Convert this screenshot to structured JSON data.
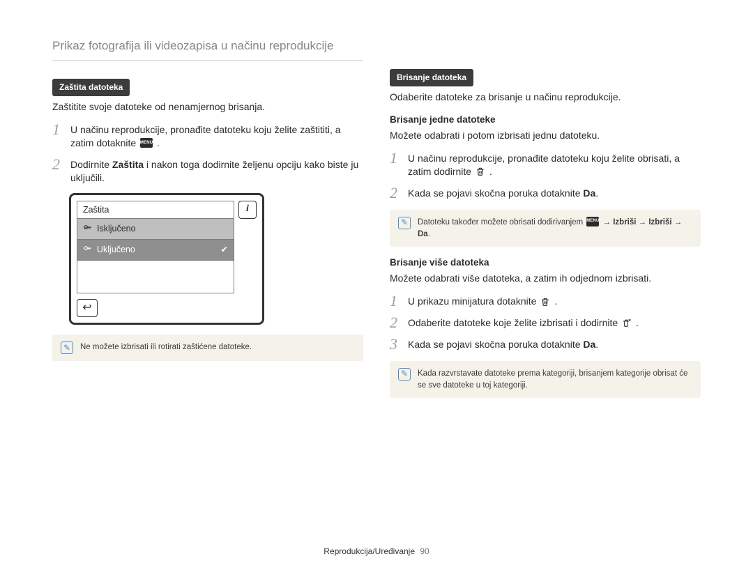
{
  "page_title": "Prikaz fotografija ili videozapisa u načinu reprodukcije",
  "footer": {
    "section": "Reprodukcija/Uređivanje",
    "page": "90"
  },
  "left": {
    "badge": "Zaštita datoteka",
    "intro": "Zaštitite svoje datoteke od nenamjernog brisanja.",
    "step1_a": "U načinu reprodukcije, pronađite datoteku koju želite zaštititi, a zatim dotaknite ",
    "step1_b": ".",
    "step2_a": "Dodirnite ",
    "step2_bold": "Zaštita",
    "step2_b": " i nakon toga dodirnite željenu opciju kako biste ju uključili.",
    "device": {
      "title": "Zaštita",
      "off": "Isključeno",
      "on": "Uključeno",
      "info_glyph": "i",
      "back_glyph": "↩",
      "tick_glyph": "✔"
    },
    "note": "Ne možete izbrisati ili rotirati zaštićene datoteke."
  },
  "right": {
    "badge": "Brisanje datoteka",
    "intro": "Odaberite datoteke za brisanje u načinu reprodukcije.",
    "sub1": "Brisanje jedne datoteke",
    "sub1_intro": "Možete odabrati i potom izbrisati jednu datoteku.",
    "s1_step1_a": "U načinu reprodukcije, pronađite datoteku koju želite obrisati, a zatim dodirnite ",
    "s1_step1_b": ".",
    "s1_step2_a": "Kada se pojavi skočna poruka dotaknite ",
    "s1_step2_bold": "Da",
    "s1_step2_b": ".",
    "note1_a": "Datoteku također možete obrisati dodirivanjem ",
    "note1_b": " → ",
    "note1_c": "Izbriši",
    "note1_d": " → ",
    "note1_e": "Izbriši",
    "note1_f": " → ",
    "note1_g": "Da",
    "note1_h": ".",
    "sub2": "Brisanje više datoteka",
    "sub2_intro": "Možete odabrati više datoteka, a zatim ih odjednom izbrisati.",
    "s2_step1_a": "U prikazu minijatura dotaknite ",
    "s2_step1_b": ".",
    "s2_step2_a": "Odaberite datoteke koje želite izbrisati i dodirnite ",
    "s2_step2_b": ".",
    "s2_step3_a": "Kada se pojavi skočna poruka dotaknite ",
    "s2_step3_bold": "Da",
    "s2_step3_b": ".",
    "note2": "Kada razvrstavate datoteke prema kategoriji, brisanjem kategorije obrisat će se sve datoteke u toj kategoriji."
  },
  "note_glyph": "✎"
}
